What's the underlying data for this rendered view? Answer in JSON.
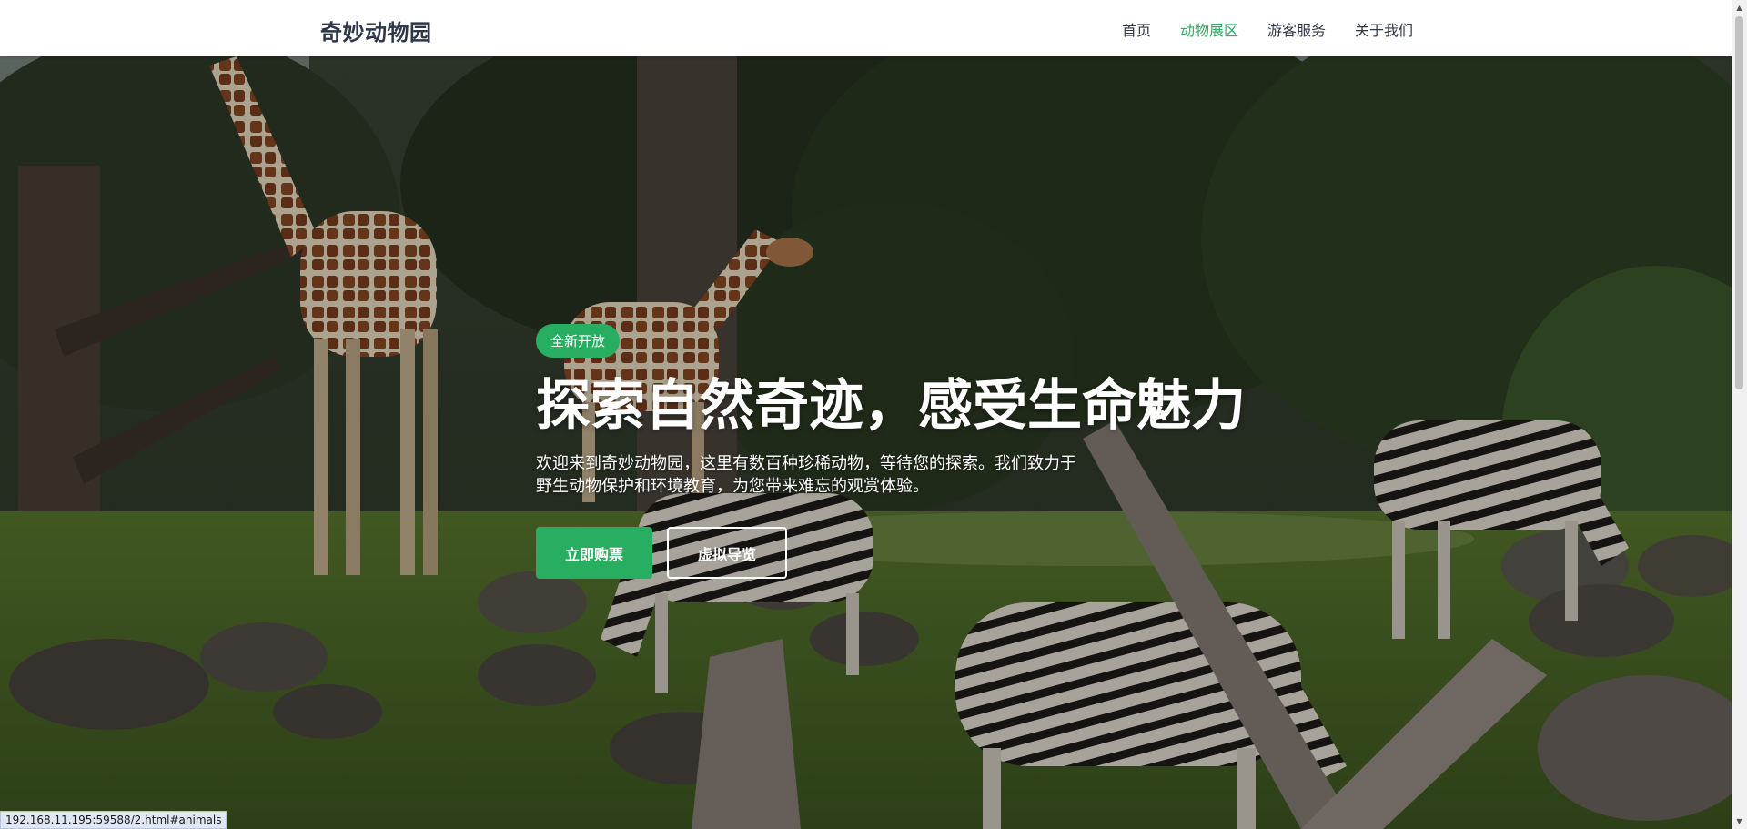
{
  "navbar": {
    "brand": "奇妙动物园",
    "links": [
      {
        "label": "首页",
        "active": false
      },
      {
        "label": "动物展区",
        "active": true
      },
      {
        "label": "游客服务",
        "active": false
      },
      {
        "label": "关于我们",
        "active": false
      }
    ]
  },
  "hero": {
    "badge": "全新开放",
    "title": "探索自然奇迹，感受生命魅力",
    "description": "欢迎来到奇妙动物园，这里有数百种珍稀动物，等待您的探索。我们致力于野生动物保护和环境教育，为您带来难忘的观赏体验。",
    "primary_button": "立即购票",
    "secondary_button": "虚拟导览"
  },
  "status_bar": {
    "url": "192.168.11.195:59588/2.html#animals"
  },
  "colors": {
    "accent": "#27ae60",
    "nav_text": "#2d3748",
    "hero_text": "#ffffff"
  },
  "icons": {
    "scroll_up": "triangle-up-icon",
    "scroll_down": "triangle-down-icon"
  }
}
